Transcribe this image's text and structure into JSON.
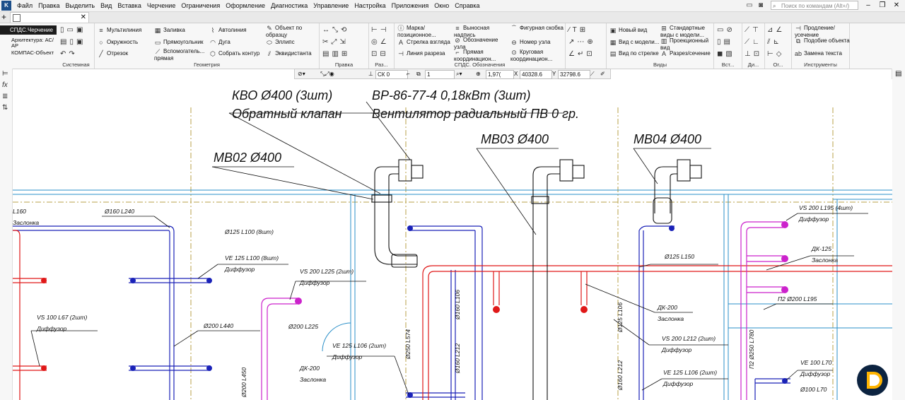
{
  "menubar": {
    "items": [
      "Файл",
      "Правка",
      "Выделить",
      "Вид",
      "Вставка",
      "Черчение",
      "Ограничения",
      "Оформление",
      "Диагностика",
      "Управление",
      "Настройка",
      "Приложения",
      "Окно",
      "Справка"
    ],
    "search_placeholder": "Поиск по командам (Alt+/)"
  },
  "profiles": {
    "selected": "СПДС.Черчение",
    "option1": "Архитектура: АС/АР",
    "option2": "КОМПАС-Объект"
  },
  "ribbon": {
    "groups": {
      "system": "Системная",
      "geometry": "Геометрия",
      "edit": "Правка",
      "sizes": "Раз...",
      "spds": "СПДС. Обозначения",
      "views": "Виды",
      "insert": "Вст...",
      "di": "Ди...",
      "og": "Ог...",
      "tools": "Инструменты"
    },
    "geometry": {
      "multiline": "Мультилиния",
      "circle": "Окружность",
      "segment": "Отрезок",
      "fill": "Заливка",
      "rectangle": "Прямоугольник",
      "aux_line": "Вспомогатель... прямая",
      "autoline": "Автолиния",
      "arc": "Дуга",
      "collect": "Собрать контур",
      "by_sample": "Объект по образцу",
      "ellipse": "Эллипс",
      "equidistant": "Эквидистанта"
    },
    "spds": {
      "mark": "Марка/ позиционное...",
      "view_arrow": "Стрелка взгляда",
      "cut_line": "Линия разреза",
      "leader": "Выносная надпись",
      "node": "Обозначение узла",
      "straight_coord": "Прямая координацион...",
      "figure_bracket": "Фигурная скобка",
      "node_number": "Номер узла",
      "circle_coord": "Круговая координацион..."
    },
    "views": {
      "new_view": "Новый вид",
      "from_model": "Вид с модели...",
      "by_arrow": "Вид по стрелке",
      "standard": "Стандартные виды с модели...",
      "projection": "Проекционный вид",
      "section": "Разрез/сечение"
    },
    "tools": {
      "extend": "Продление/ усечение",
      "similar": "Подобие объекта",
      "replace_text": "Замена текста"
    }
  },
  "subtoolbar": {
    "cs": "СК 0",
    "layer": "1",
    "scale": "1,97(",
    "x_label": "X",
    "x_value": "40328.6",
    "y_label": "Y",
    "y_value": "32798.6"
  },
  "drawing": {
    "labels": [
      {
        "text": "КВО Ø400 (3шт)"
      },
      {
        "text": "Обратный клапан"
      },
      {
        "text": "ВР-86-77-4 0,18кВт (3шт)"
      },
      {
        "text": "Вентилятор радиальный ПВ 0 гр."
      },
      {
        "text": "МВ03 Ø400"
      },
      {
        "text": "МВ04 Ø400"
      },
      {
        "text": "МВ02 Ø400"
      }
    ],
    "small": [
      "L160",
      "Заслонка",
      "Ø160 L240",
      "Ø125 L100 (8шт)",
      "VE 125 L100 (8шт)",
      "Диффузор",
      "VS 100 L67 (2шт)",
      "Диффузор",
      "Ø200 L440",
      "VS 200 L225 (2шт)",
      "Диффузор",
      "Ø200 L225",
      "VE 125 L106 (2шт)",
      "Диффузор",
      "ДК-200",
      "Заслонка",
      "Ø200 L450",
      "Ø250 L574",
      "Ø160 L106",
      "Ø160 L212",
      "Ø125 L150",
      "ДК-200",
      "Заслонка",
      "VS 200 L212 (2шт)",
      "Диффузор",
      "VE 125 L106 (2шт)",
      "Диффузор",
      "Ø125 L106",
      "Ø160 L212",
      "VS 200 L195 (4шт)",
      "Диффузор",
      "ДК-125",
      "Заслонка",
      "П2 Ø200 L195",
      "П2 Ø250 L780",
      "VE 100 L70",
      "Диффузор",
      "Ø100 L70"
    ]
  },
  "colors": {
    "blue": "#1a22b8",
    "red": "#e01818",
    "magenta": "#cc22cc",
    "cyan": "#2a8fc8",
    "olive": "#b8a24a",
    "dark": "#111111"
  }
}
